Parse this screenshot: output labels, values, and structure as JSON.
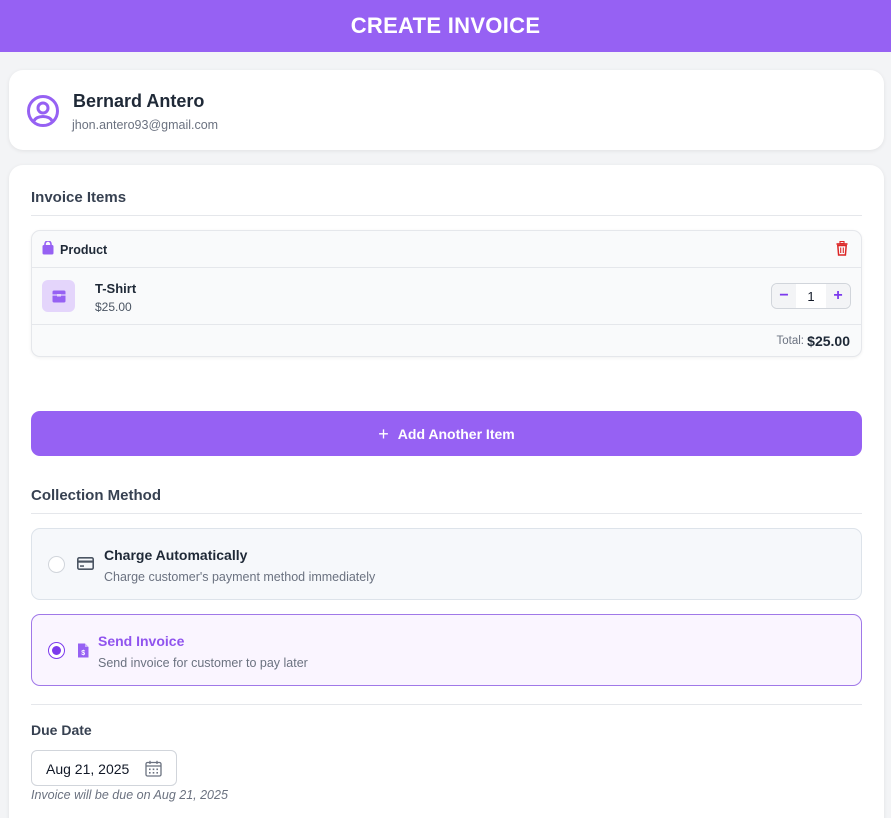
{
  "header": {
    "title": "CREATE INVOICE"
  },
  "customer": {
    "name": "Bernard Antero",
    "email": "jhon.antero93@gmail.com",
    "icon": "user-circle-icon"
  },
  "items_section": {
    "title": "Invoice Items",
    "items": [
      {
        "type_label": "Product",
        "name": "T-Shirt",
        "price": "$25.00",
        "quantity": "1",
        "total_label": "Total:",
        "total_value": "$25.00"
      }
    ],
    "add_button_label": "Add Another Item"
  },
  "collection": {
    "title": "Collection Method",
    "options": [
      {
        "title": "Charge Automatically",
        "description": "Charge customer's payment method immediately",
        "selected": false,
        "icon": "credit-card-icon"
      },
      {
        "title": "Send Invoice",
        "description": "Send invoice for customer to pay later",
        "selected": true,
        "icon": "invoice-doc-icon"
      }
    ]
  },
  "due_date": {
    "label": "Due Date",
    "value": "Aug 21, 2025",
    "note": "Invoice will be due on Aug 21, 2025"
  },
  "colors": {
    "accent": "#9661f3",
    "accent_dark": "#7c3aed",
    "danger": "#dc2626"
  }
}
